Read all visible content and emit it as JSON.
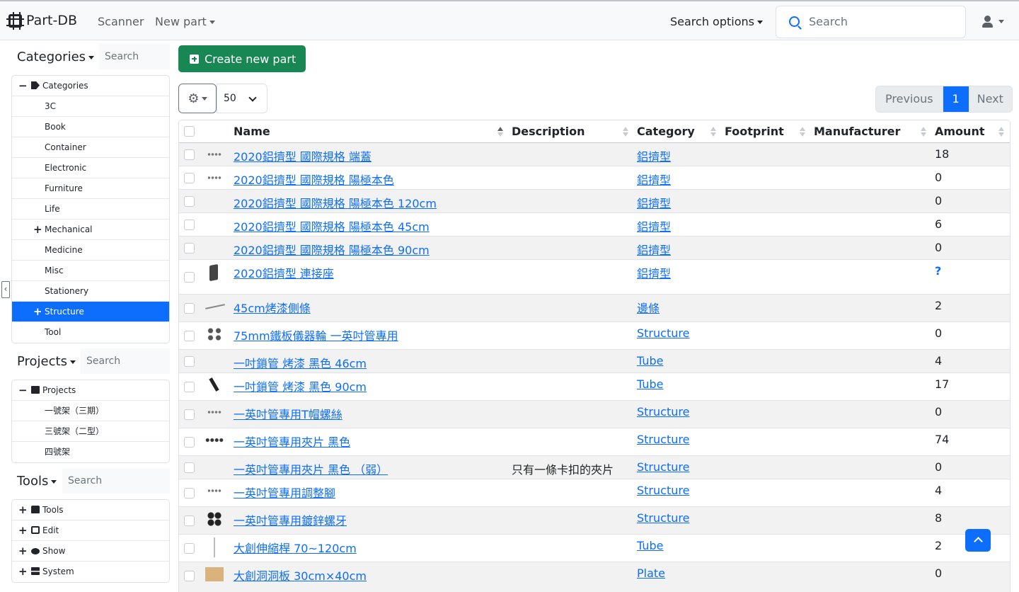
{
  "navbar": {
    "brand": "Part-DB",
    "scanner": "Scanner",
    "new_part": "New part",
    "search_options": "Search options",
    "search_placeholder": "Search"
  },
  "sidebar": {
    "categories": {
      "title": "Categories",
      "search_placeholder": "Search",
      "root": "Categories",
      "items": [
        "3C",
        "Book",
        "Container",
        "Electronic",
        "Furniture",
        "Life",
        "Mechanical",
        "Medicine",
        "Misc",
        "Stationery",
        "Structure",
        "Tool"
      ],
      "active": "Structure"
    },
    "projects": {
      "title": "Projects",
      "search_placeholder": "Search",
      "root": "Projects",
      "items": [
        "一號架（三期）",
        "三號架（二型）",
        "四號架"
      ]
    },
    "tools": {
      "title": "Tools",
      "search_placeholder": "Search",
      "items": [
        "Tools",
        "Edit",
        "Show",
        "System"
      ]
    }
  },
  "main": {
    "create_button": "Create new part",
    "per_page": "50",
    "pagination": {
      "previous": "Previous",
      "current": "1",
      "next": "Next"
    },
    "columns": [
      "Name",
      "Description",
      "Category",
      "Footprint",
      "Manufacturer",
      "Amount"
    ],
    "rows": [
      {
        "name": "2020鋁擠型 國際規格 端蓋",
        "description": "",
        "category": "鋁擠型",
        "amount": "18"
      },
      {
        "name": "2020鋁擠型 國際規格 陽極本色",
        "description": "",
        "category": "鋁擠型",
        "amount": "0"
      },
      {
        "name": "2020鋁擠型 國際規格 陽極本色 120cm",
        "description": "",
        "category": "鋁擠型",
        "amount": "0"
      },
      {
        "name": "2020鋁擠型 國際規格 陽極本色 45cm",
        "description": "",
        "category": "鋁擠型",
        "amount": "6"
      },
      {
        "name": "2020鋁擠型 國際規格 陽極本色 90cm",
        "description": "",
        "category": "鋁擠型",
        "amount": "0"
      },
      {
        "name": "2020鋁擠型 連接座",
        "description": "",
        "category": "鋁擠型",
        "amount": "?"
      },
      {
        "name": "45cm烤漆側條",
        "description": "",
        "category": "邊條",
        "amount": "2"
      },
      {
        "name": "75mm鐵板儀器輪 一英吋管專用",
        "description": "",
        "category": "Structure",
        "amount": "0"
      },
      {
        "name": "一吋鎖管 烤漆 黑色 46cm",
        "description": "",
        "category": "Tube",
        "amount": "4"
      },
      {
        "name": "一吋鎖管 烤漆 黑色 90cm",
        "description": "",
        "category": "Tube",
        "amount": "17"
      },
      {
        "name": "一英吋管專用T帽螺絲",
        "description": "",
        "category": "Structure",
        "amount": "0"
      },
      {
        "name": "一英吋管專用夾片 黑色",
        "description": "",
        "category": "Structure",
        "amount": "74"
      },
      {
        "name": "一英吋管專用夾片 黑色 （弱）",
        "description": "只有一條卡扣的夾片",
        "category": "Structure",
        "amount": "0"
      },
      {
        "name": "一英吋管專用調整腳",
        "description": "",
        "category": "Structure",
        "amount": "4"
      },
      {
        "name": "一英吋管專用鍍鋅螺牙",
        "description": "",
        "category": "Structure",
        "amount": "8"
      },
      {
        "name": "大創伸縮桿 70~120cm",
        "description": "",
        "category": "Tube",
        "amount": "2"
      },
      {
        "name": "大創洞洞板 30cm×40cm",
        "description": "",
        "category": "Plate",
        "amount": "0"
      }
    ]
  }
}
